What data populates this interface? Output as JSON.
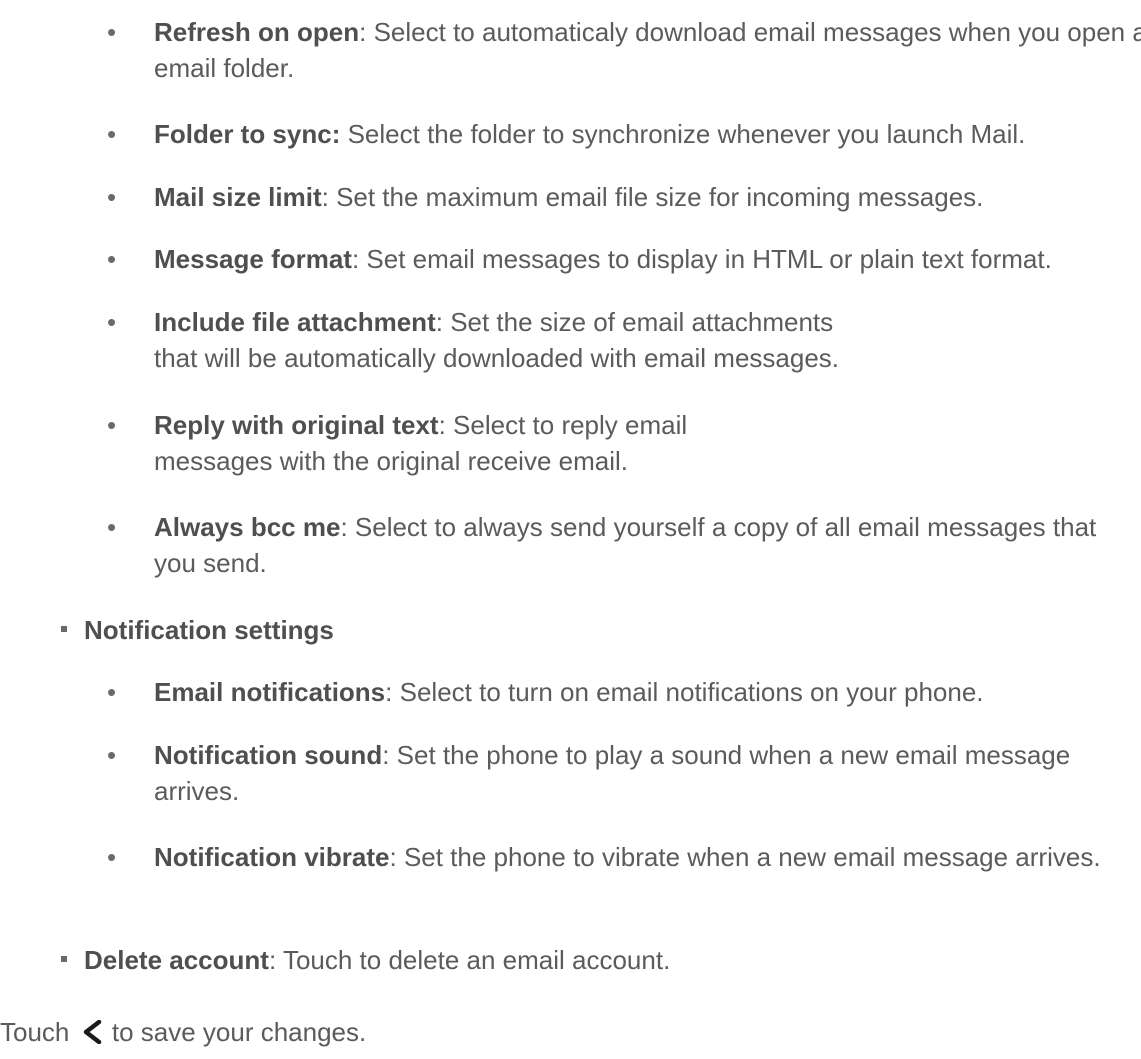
{
  "list": {
    "items": [
      {
        "term": "Refresh on open",
        "sep": ": ",
        "desc": "Select to automaticaly download email messages when you open an email folder."
      },
      {
        "term": "Folder to sync:",
        "sep": " ",
        "desc": "Select the folder to synchronize whenever you launch Mail."
      },
      {
        "term": "Mail size limit",
        "sep": ": ",
        "desc": "Set the maximum email file size for incoming messages."
      },
      {
        "term": "Message format",
        "sep": ": ",
        "desc": "Set email messages to display in HTML or plain text format."
      },
      {
        "term": "Include file attachment",
        "sep": ": ",
        "desc": "Set the size of email attachments that will be automatically downloaded with email messages."
      },
      {
        "term": "Reply with original text",
        "sep": ": ",
        "desc": "Select to reply email messages with the original receive email."
      },
      {
        "term": "Always bcc me",
        "sep": ": ",
        "desc": "Select to always send yourself a copy of all email messages that you send."
      }
    ],
    "notification_settings": {
      "heading": "Notification settings",
      "items": [
        {
          "term": "Email notifications",
          "sep": ": ",
          "desc": "Select to turn on email notifications on your phone."
        },
        {
          "term": "Notification sound",
          "sep": ": ",
          "desc": "Set the phone to play a sound when a new email message arrives."
        },
        {
          "term": "Notification vibrate",
          "sep": ": ",
          "desc": "Set the phone to vibrate when a new email message arrives."
        }
      ]
    },
    "delete_account": {
      "term": "Delete account",
      "sep": ": ",
      "desc": "Touch to delete an email account."
    }
  },
  "footer": {
    "before_icon": "Touch",
    "after_icon": "to save your changes.",
    "icon": "back-chevron-icon"
  },
  "bullets": {
    "dot": "•"
  }
}
